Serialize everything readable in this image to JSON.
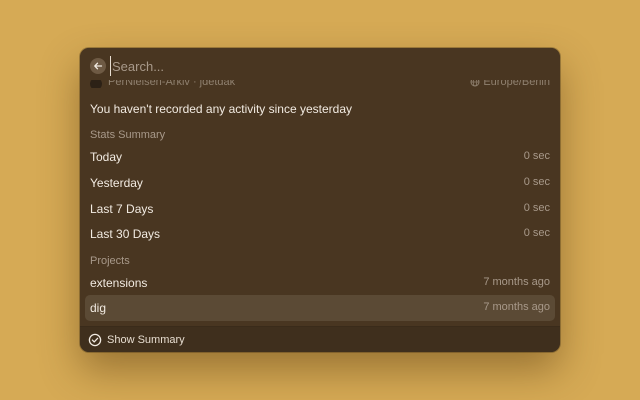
{
  "search": {
    "placeholder": "Search..."
  },
  "profile": {
    "name": "PerNielsen-Arkiv · jdetdak",
    "timezone": "Europe/Berlin"
  },
  "message": "You haven't recorded any activity since yesterday",
  "stats": {
    "title": "Stats Summary",
    "items": [
      {
        "label": "Today",
        "value": "0 sec"
      },
      {
        "label": "Yesterday",
        "value": "0 sec"
      },
      {
        "label": "Last 7 Days",
        "value": "0 sec"
      },
      {
        "label": "Last 30 Days",
        "value": "0 sec"
      }
    ]
  },
  "projects": {
    "title": "Projects",
    "items": [
      {
        "label": "extensions",
        "value": "7 months ago"
      },
      {
        "label": "dig",
        "value": "7 months ago"
      }
    ]
  },
  "footer": {
    "action_label": "Show Summary"
  },
  "icons": {
    "back": "arrow-left-icon",
    "globe": "globe-icon",
    "action": "check-circle-icon"
  },
  "colors": {
    "background": "#d6aa55",
    "window": "#493621",
    "selected_row": "#5b4a35"
  }
}
